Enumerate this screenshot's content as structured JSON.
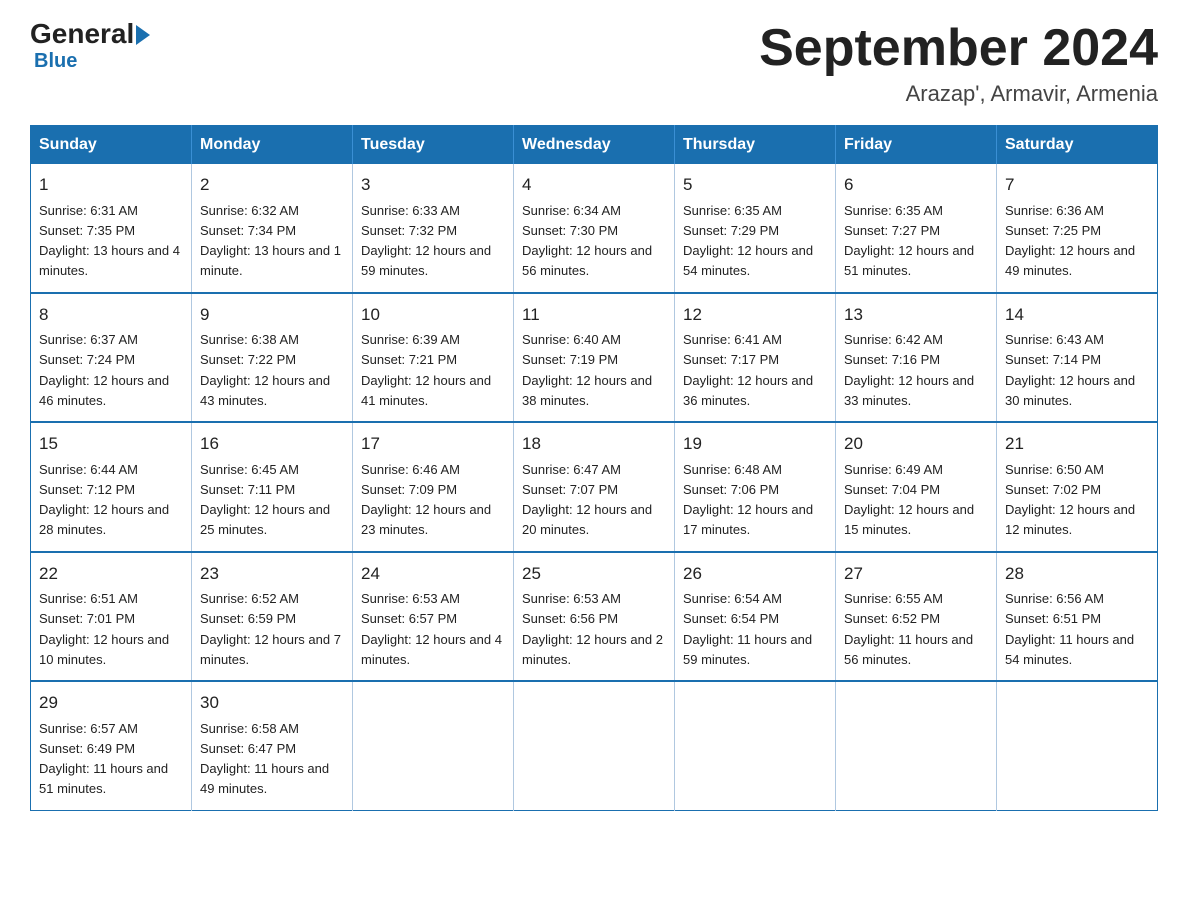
{
  "logo": {
    "general": "General",
    "blue": "Blue",
    "subtitle": "Blue"
  },
  "header": {
    "month_title": "September 2024",
    "location": "Arazap', Armavir, Armenia"
  },
  "weekdays": [
    "Sunday",
    "Monday",
    "Tuesday",
    "Wednesday",
    "Thursday",
    "Friday",
    "Saturday"
  ],
  "weeks": [
    [
      {
        "day": "1",
        "sunrise": "6:31 AM",
        "sunset": "7:35 PM",
        "daylight": "13 hours and 4 minutes."
      },
      {
        "day": "2",
        "sunrise": "6:32 AM",
        "sunset": "7:34 PM",
        "daylight": "13 hours and 1 minute."
      },
      {
        "day": "3",
        "sunrise": "6:33 AM",
        "sunset": "7:32 PM",
        "daylight": "12 hours and 59 minutes."
      },
      {
        "day": "4",
        "sunrise": "6:34 AM",
        "sunset": "7:30 PM",
        "daylight": "12 hours and 56 minutes."
      },
      {
        "day": "5",
        "sunrise": "6:35 AM",
        "sunset": "7:29 PM",
        "daylight": "12 hours and 54 minutes."
      },
      {
        "day": "6",
        "sunrise": "6:35 AM",
        "sunset": "7:27 PM",
        "daylight": "12 hours and 51 minutes."
      },
      {
        "day": "7",
        "sunrise": "6:36 AM",
        "sunset": "7:25 PM",
        "daylight": "12 hours and 49 minutes."
      }
    ],
    [
      {
        "day": "8",
        "sunrise": "6:37 AM",
        "sunset": "7:24 PM",
        "daylight": "12 hours and 46 minutes."
      },
      {
        "day": "9",
        "sunrise": "6:38 AM",
        "sunset": "7:22 PM",
        "daylight": "12 hours and 43 minutes."
      },
      {
        "day": "10",
        "sunrise": "6:39 AM",
        "sunset": "7:21 PM",
        "daylight": "12 hours and 41 minutes."
      },
      {
        "day": "11",
        "sunrise": "6:40 AM",
        "sunset": "7:19 PM",
        "daylight": "12 hours and 38 minutes."
      },
      {
        "day": "12",
        "sunrise": "6:41 AM",
        "sunset": "7:17 PM",
        "daylight": "12 hours and 36 minutes."
      },
      {
        "day": "13",
        "sunrise": "6:42 AM",
        "sunset": "7:16 PM",
        "daylight": "12 hours and 33 minutes."
      },
      {
        "day": "14",
        "sunrise": "6:43 AM",
        "sunset": "7:14 PM",
        "daylight": "12 hours and 30 minutes."
      }
    ],
    [
      {
        "day": "15",
        "sunrise": "6:44 AM",
        "sunset": "7:12 PM",
        "daylight": "12 hours and 28 minutes."
      },
      {
        "day": "16",
        "sunrise": "6:45 AM",
        "sunset": "7:11 PM",
        "daylight": "12 hours and 25 minutes."
      },
      {
        "day": "17",
        "sunrise": "6:46 AM",
        "sunset": "7:09 PM",
        "daylight": "12 hours and 23 minutes."
      },
      {
        "day": "18",
        "sunrise": "6:47 AM",
        "sunset": "7:07 PM",
        "daylight": "12 hours and 20 minutes."
      },
      {
        "day": "19",
        "sunrise": "6:48 AM",
        "sunset": "7:06 PM",
        "daylight": "12 hours and 17 minutes."
      },
      {
        "day": "20",
        "sunrise": "6:49 AM",
        "sunset": "7:04 PM",
        "daylight": "12 hours and 15 minutes."
      },
      {
        "day": "21",
        "sunrise": "6:50 AM",
        "sunset": "7:02 PM",
        "daylight": "12 hours and 12 minutes."
      }
    ],
    [
      {
        "day": "22",
        "sunrise": "6:51 AM",
        "sunset": "7:01 PM",
        "daylight": "12 hours and 10 minutes."
      },
      {
        "day": "23",
        "sunrise": "6:52 AM",
        "sunset": "6:59 PM",
        "daylight": "12 hours and 7 minutes."
      },
      {
        "day": "24",
        "sunrise": "6:53 AM",
        "sunset": "6:57 PM",
        "daylight": "12 hours and 4 minutes."
      },
      {
        "day": "25",
        "sunrise": "6:53 AM",
        "sunset": "6:56 PM",
        "daylight": "12 hours and 2 minutes."
      },
      {
        "day": "26",
        "sunrise": "6:54 AM",
        "sunset": "6:54 PM",
        "daylight": "11 hours and 59 minutes."
      },
      {
        "day": "27",
        "sunrise": "6:55 AM",
        "sunset": "6:52 PM",
        "daylight": "11 hours and 56 minutes."
      },
      {
        "day": "28",
        "sunrise": "6:56 AM",
        "sunset": "6:51 PM",
        "daylight": "11 hours and 54 minutes."
      }
    ],
    [
      {
        "day": "29",
        "sunrise": "6:57 AM",
        "sunset": "6:49 PM",
        "daylight": "11 hours and 51 minutes."
      },
      {
        "day": "30",
        "sunrise": "6:58 AM",
        "sunset": "6:47 PM",
        "daylight": "11 hours and 49 minutes."
      },
      null,
      null,
      null,
      null,
      null
    ]
  ]
}
